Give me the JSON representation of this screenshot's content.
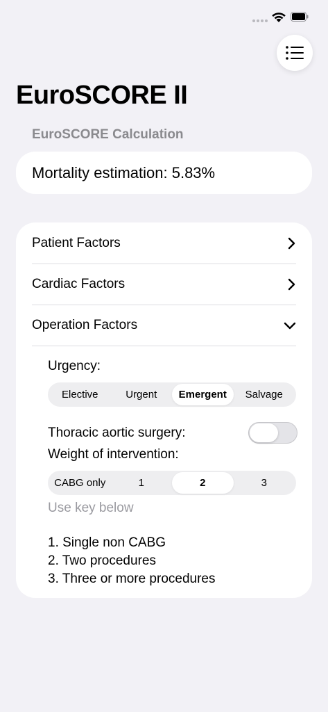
{
  "status_bar": {
    "signal_icon": "cellular-signal-icon",
    "wifi_icon": "wifi-icon",
    "battery_icon": "battery-icon"
  },
  "toolbar": {
    "menu_icon": "list-icon"
  },
  "page": {
    "title": "EuroSCORE II"
  },
  "calculation": {
    "header": "EuroSCORE Calculation",
    "mortality_text": "Mortality estimation: 5.83%"
  },
  "factors": {
    "sections": [
      {
        "label": "Patient Factors",
        "state": "collapsed",
        "icon": "chevron-right-icon"
      },
      {
        "label": "Cardiac Factors",
        "state": "collapsed",
        "icon": "chevron-right-icon"
      },
      {
        "label": "Operation Factors",
        "state": "expanded",
        "icon": "chevron-down-icon"
      }
    ],
    "urgency": {
      "label": "Urgency:",
      "options": [
        "Elective",
        "Urgent",
        "Emergent",
        "Salvage"
      ],
      "selected": "Emergent"
    },
    "thoracic": {
      "label": "Thoracic aortic surgery:",
      "enabled": false
    },
    "weight": {
      "label": "Weight of intervention:",
      "options": [
        "CABG only",
        "1",
        "2",
        "3"
      ],
      "selected": "2",
      "hint": "Use key below"
    },
    "key": [
      "1. Single non CABG",
      "2. Two procedures",
      "3. Three or more procedures"
    ]
  },
  "colors": {
    "background": "#f2f1f6",
    "card": "#ffffff",
    "secondary_text": "#8a8a8e",
    "segment_bg": "#eeeef0"
  }
}
